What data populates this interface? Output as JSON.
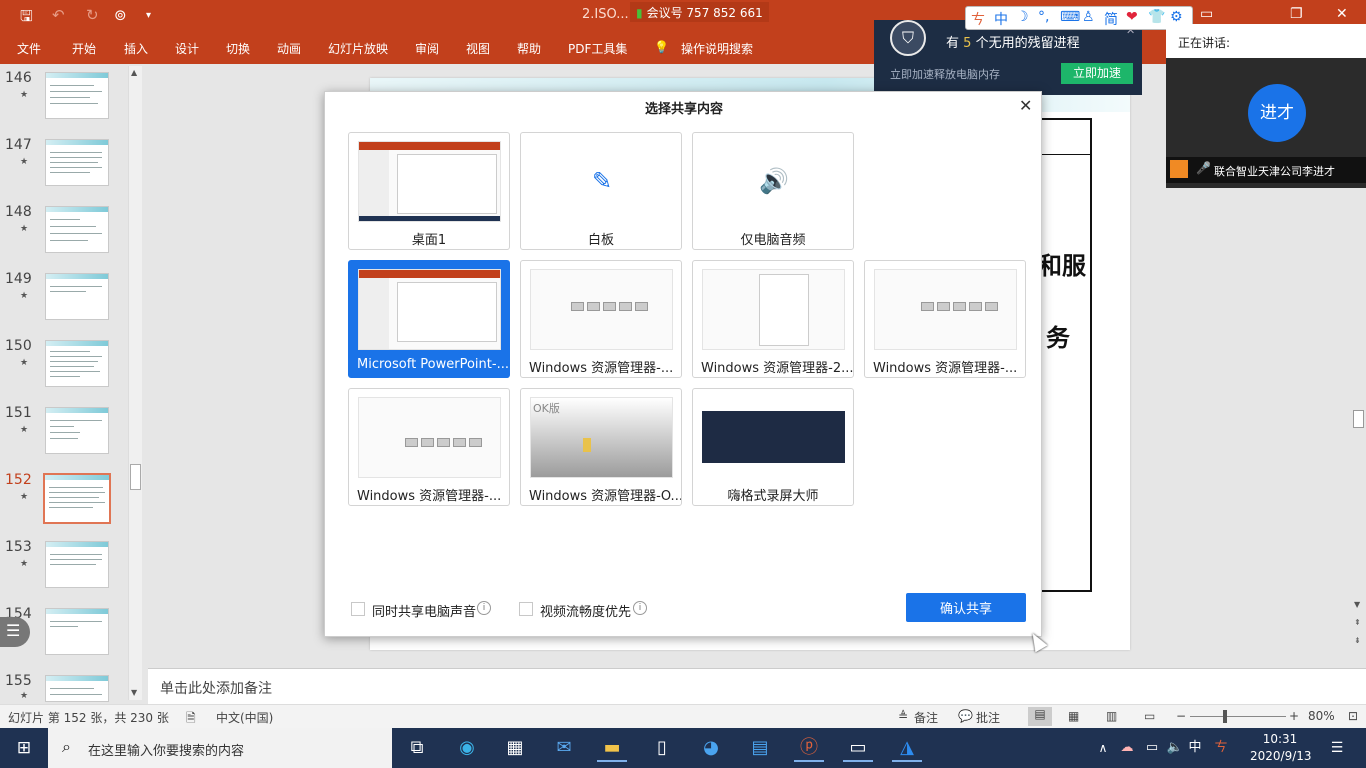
{
  "titlebar": {
    "doc_title": "2.ISO... .ow... oint",
    "meeting_id": "会议号 757 852 661",
    "undo_label": "↶",
    "redo_label": "↻",
    "save_label": "🖫"
  },
  "ribbon": {
    "tabs": [
      "文件",
      "开始",
      "插入",
      "设计",
      "切换",
      "动画",
      "幻灯片放映",
      "审阅",
      "视图",
      "帮助",
      "PDF工具集",
      "操作说明搜索"
    ]
  },
  "thumbnails": {
    "items": [
      {
        "num": "146"
      },
      {
        "num": "147"
      },
      {
        "num": "148"
      },
      {
        "num": "149"
      },
      {
        "num": "150"
      },
      {
        "num": "151"
      },
      {
        "num": "152"
      },
      {
        "num": "153"
      },
      {
        "num": "154"
      },
      {
        "num": "155"
      }
    ],
    "selected": "152",
    "star": "★"
  },
  "slide": {
    "text1": "和服",
    "text2": "务"
  },
  "notes": {
    "placeholder": "单击此处添加备注"
  },
  "statusbar": {
    "slide_info": "幻灯片 第 152 张，共 230 张",
    "language": "中文(中国)",
    "notes_label": "备注",
    "comments_label": "批注",
    "zoom": "80%"
  },
  "dialog": {
    "title": "选择共享内容",
    "cards": [
      {
        "label": "桌面1"
      },
      {
        "label": "白板"
      },
      {
        "label": "仅电脑音频"
      },
      {
        "label": "Microsoft PowerPoint-..."
      },
      {
        "label": "Windows 资源管理器-..."
      },
      {
        "label": "Windows 资源管理器-2..."
      },
      {
        "label": "Windows 资源管理器-..."
      },
      {
        "label": "Windows 资源管理器-..."
      },
      {
        "label": "Windows 资源管理器-O..."
      },
      {
        "label": "嗨格式录屏大师"
      }
    ],
    "ok_badge": "OK版",
    "share_audio": "同时共享电脑声音",
    "video_priority": "视频流畅度优先",
    "confirm": "确认共享"
  },
  "cleanup": {
    "msg_prefix": "有",
    "count": "5",
    "msg_suffix": "个无用的残留进程",
    "sub": "立即加速释放电脑内存",
    "button": "立即加速"
  },
  "speaker": {
    "header": "正在讲话:",
    "avatar": "进才",
    "name": "联合智业天津公司李进才"
  },
  "taskbar": {
    "search_placeholder": "在这里输入你要搜索的内容",
    "time": "10:31",
    "date": "2020/9/13",
    "ime": "中"
  },
  "colors": {
    "accent": "#c2401c",
    "share_blue": "#1a73e8",
    "cleanup_green": "#1db66a"
  }
}
